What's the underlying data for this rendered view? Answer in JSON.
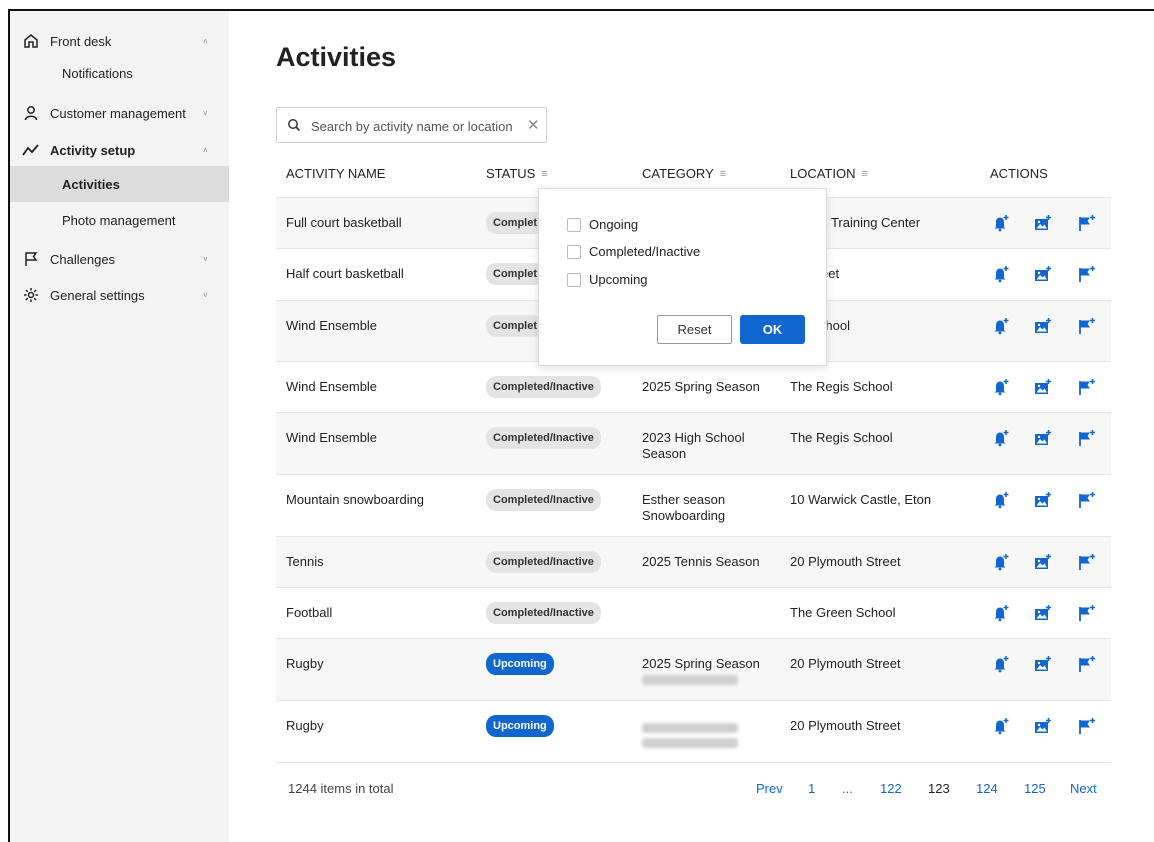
{
  "sidebar": {
    "items": [
      {
        "label": "Front desk",
        "icon": "home-icon"
      },
      {
        "label": "Notifications"
      },
      {
        "label": "Customer management",
        "icon": "user-icon"
      },
      {
        "label": "Activity setup",
        "icon": "activity-icon"
      },
      {
        "label": "Activities"
      },
      {
        "label": "Photo management"
      },
      {
        "label": "Challenges",
        "icon": "flag-icon"
      },
      {
        "label": "General settings",
        "icon": "gear-icon"
      }
    ],
    "chevron_up": "˄",
    "chevron_down": "˅"
  },
  "page": {
    "title": "Activities"
  },
  "search": {
    "placeholder": "Search by activity name or location",
    "clear": "✕"
  },
  "table": {
    "headers": {
      "name": "ACTIVITY NAME",
      "status": "STATUS",
      "category": "CATEGORY",
      "location": "LOCATION",
      "actions": "ACTIONS"
    },
    "filter_glyph": "≡",
    "rows": [
      {
        "name": "Full court basketball",
        "status": "Complet",
        "category": "",
        "location": "Sports Training Center"
      },
      {
        "name": "Half court basketball",
        "status": "Complet",
        "category": "",
        "location": "wnstreet"
      },
      {
        "name": "Wind Ensemble",
        "status": "Complet",
        "category": "",
        "location": "gis School"
      },
      {
        "name": "Wind Ensemble",
        "status": "Completed/Inactive",
        "category": "2025 Spring Season",
        "location": "The Regis School"
      },
      {
        "name": "Wind Ensemble",
        "status": "Completed/Inactive",
        "category": "2023 High School Season",
        "location": "The Regis School"
      },
      {
        "name": "Mountain snowboarding",
        "status": "Completed/Inactive",
        "category": "Esther season Snowboarding",
        "location": "10 Warwick Castle, Eton"
      },
      {
        "name": "Tennis",
        "status": "Completed/Inactive",
        "category": "2025 Tennis Season",
        "location": "20 Plymouth Street"
      },
      {
        "name": "Football",
        "status": "Completed/Inactive",
        "category": "",
        "location": "The Green School"
      },
      {
        "name": "Rugby",
        "status": "Upcoming",
        "category": "2025 Spring Season",
        "location": "20 Plymouth Street"
      },
      {
        "name": "Rugby",
        "status": "Upcoming",
        "category": "",
        "location": "20 Plymouth Street"
      }
    ]
  },
  "filter_popup": {
    "options": [
      "Ongoing",
      "Completed/Inactive",
      "Upcoming"
    ],
    "reset": "Reset",
    "ok": "OK"
  },
  "footer": {
    "total": "1244 items in total",
    "prev": "Prev",
    "pages": [
      "1",
      "...",
      "122",
      "123",
      "124",
      "125"
    ],
    "current": "123",
    "next": "Next"
  },
  "colors": {
    "accent": "#1167cf",
    "sidebar_bg": "#f3f3f3",
    "active_bg": "#dcdcdc",
    "badge_gray": "#e4e4e4"
  }
}
